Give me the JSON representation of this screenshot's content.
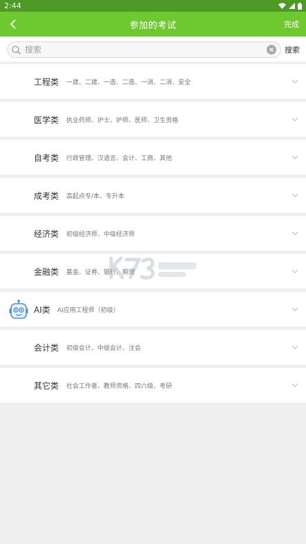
{
  "status_bar": {
    "time": "2:44"
  },
  "header": {
    "title": "参加的考试",
    "done_label": "完成"
  },
  "search": {
    "placeholder": "搜索",
    "value": "",
    "button_label": "搜索"
  },
  "categories": [
    {
      "name": "工程类",
      "desc": "一建、二建、一造、二造、一消、二消、安全"
    },
    {
      "name": "医学类",
      "desc": "执业药师、护士、护师、医师、卫生资格"
    },
    {
      "name": "自考类",
      "desc": "行政管理、汉语言、会计、工商、其他"
    },
    {
      "name": "成考类",
      "desc": "高起点专/本、专升本"
    },
    {
      "name": "经济类",
      "desc": "初级经济师、中级经济师"
    },
    {
      "name": "金融类",
      "desc": "基金、证券、银行、期货"
    },
    {
      "name": "AI类",
      "desc": "AI应用工程师（初级）"
    },
    {
      "name": "会计类",
      "desc": "初级会计、中级会计、注会"
    },
    {
      "name": "其它类",
      "desc": "社会工作者、教师资格、四六级、考研"
    }
  ],
  "icons": {
    "back": "chevron-left-icon",
    "search": "search-icon",
    "clear": "clear-icon",
    "expand": "chevron-down-icon",
    "ai": "robot-icon"
  },
  "colors": {
    "status_bar": "#4e9a26",
    "header": "#6dc92f",
    "page_bg": "#efefef",
    "row_bg": "#ffffff",
    "robot": "#4a8fd6"
  }
}
